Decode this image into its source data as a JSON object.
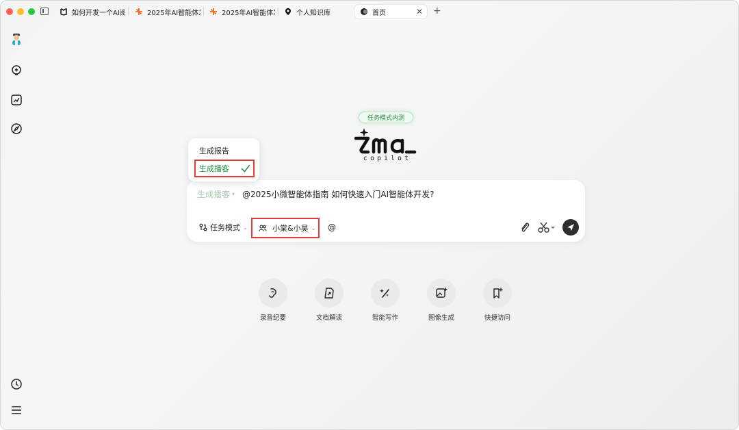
{
  "tabs": [
    {
      "label": "如何开发一个AI阅",
      "icon": "book-icon"
    },
    {
      "label": "2025年AI智能体发",
      "icon": "spark-icon"
    },
    {
      "label": "2025年AI智能体发",
      "icon": "spark-icon"
    },
    {
      "label": "个人知识库",
      "icon": "location-icon"
    },
    {
      "label": "首页",
      "icon": "ima-icon",
      "active": true
    }
  ],
  "badge": "任务模式内测",
  "logo": {
    "main": "ima",
    "sub": "copilot"
  },
  "dropdown": {
    "items": [
      {
        "label": "生成报告",
        "selected": false
      },
      {
        "label": "生成播客",
        "selected": true
      }
    ]
  },
  "input": {
    "mode_label": "生成播客",
    "prompt": "@2025小微智能体指南  如何快速入门AI智能体开发?",
    "task_mode_label": "任务模式",
    "voice_label": "小棠&小昊",
    "at_label": "@"
  },
  "quick_actions": [
    {
      "label": "录音纪要",
      "icon": "mic-icon"
    },
    {
      "label": "文档解读",
      "icon": "document-icon"
    },
    {
      "label": "智能写作",
      "icon": "magic-pen-icon"
    },
    {
      "label": "图像生成",
      "icon": "image-icon"
    },
    {
      "label": "快捷访问",
      "icon": "bookmark-icon"
    }
  ],
  "colors": {
    "accent_green": "#27944a",
    "highlight_red": "#e03b3b",
    "send_button": "#2e2e2e",
    "tab_accent_orange": "#f36b2a"
  }
}
